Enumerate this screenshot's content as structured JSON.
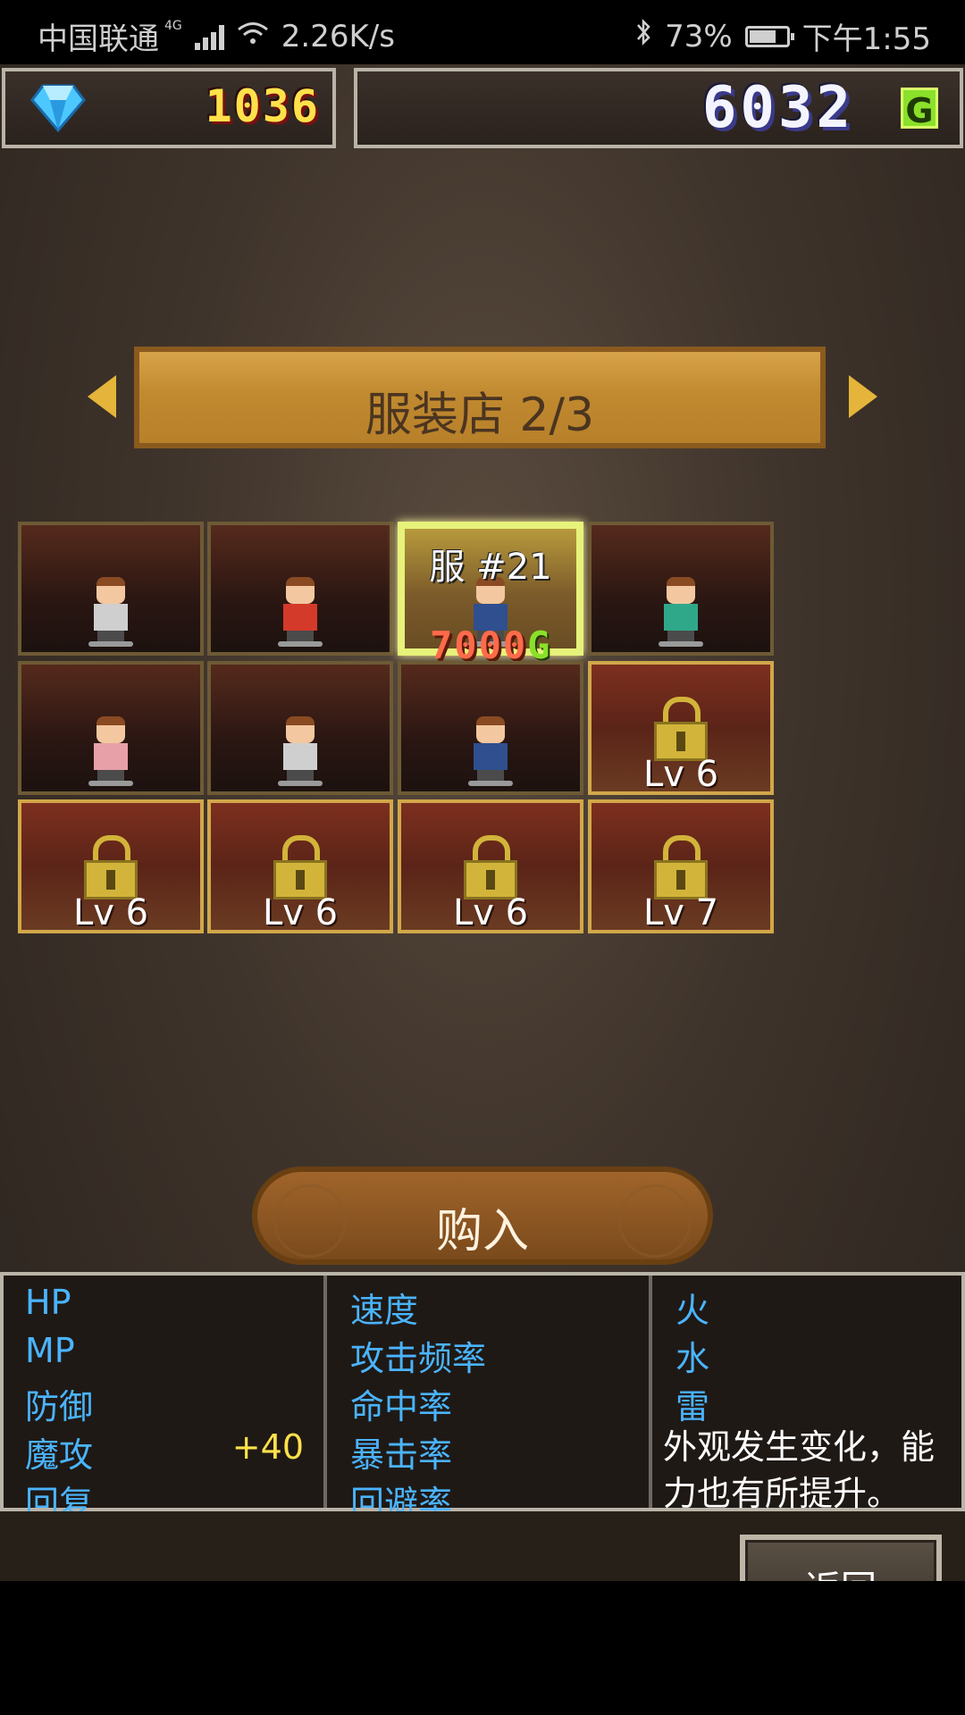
{
  "status": {
    "carrier": "中国联通",
    "network": "4G",
    "speed": "2.26K/s",
    "battery": "73%",
    "battery_level": 0.73,
    "time": "下午1:55"
  },
  "currency": {
    "gems": "1036",
    "gold": "6032",
    "gold_symbol": "G"
  },
  "shop": {
    "title": "服装店  2/3"
  },
  "slots": [
    {
      "type": "costume",
      "color": "#cfcfcf"
    },
    {
      "type": "costume",
      "color": "#d43a2a"
    },
    {
      "type": "costume",
      "color": "#2f4f8f",
      "selected": true,
      "name": "服 #21",
      "price": "7000",
      "price_symbol": "G"
    },
    {
      "type": "costume",
      "color": "#2fa88a"
    },
    {
      "type": "costume",
      "color": "#e8a0a8"
    },
    {
      "type": "costume",
      "color": "#cfcfcf"
    },
    {
      "type": "costume",
      "color": "#2f4f8f"
    },
    {
      "type": "locked",
      "level": "Lv 6"
    },
    {
      "type": "locked",
      "level": "Lv 6"
    },
    {
      "type": "locked",
      "level": "Lv 6"
    },
    {
      "type": "locked",
      "level": "Lv 6"
    },
    {
      "type": "locked",
      "level": "Lv 7"
    }
  ],
  "buy_label": "购入",
  "stats": {
    "col1": [
      {
        "label": "HP",
        "value": ""
      },
      {
        "label": "MP",
        "value": ""
      },
      {
        "label": "防御",
        "value": ""
      },
      {
        "label": "魔攻",
        "value": "+40"
      },
      {
        "label": "回复",
        "value": ""
      }
    ],
    "col2": [
      {
        "label": "速度"
      },
      {
        "label": "攻击频率"
      },
      {
        "label": "命中率"
      },
      {
        "label": "暴击率"
      },
      {
        "label": "回避率"
      }
    ],
    "col3": [
      {
        "label": "火"
      },
      {
        "label": "水"
      },
      {
        "label": "雷"
      }
    ],
    "description": "外观发生变化，能力也有所提升。"
  },
  "back_label": "返回",
  "colors": {
    "stat_label": "#4ab4ff",
    "stat_value": "#ffe24a",
    "gold_badge": "#8ae02a",
    "selected_border": "#e7f27a"
  }
}
